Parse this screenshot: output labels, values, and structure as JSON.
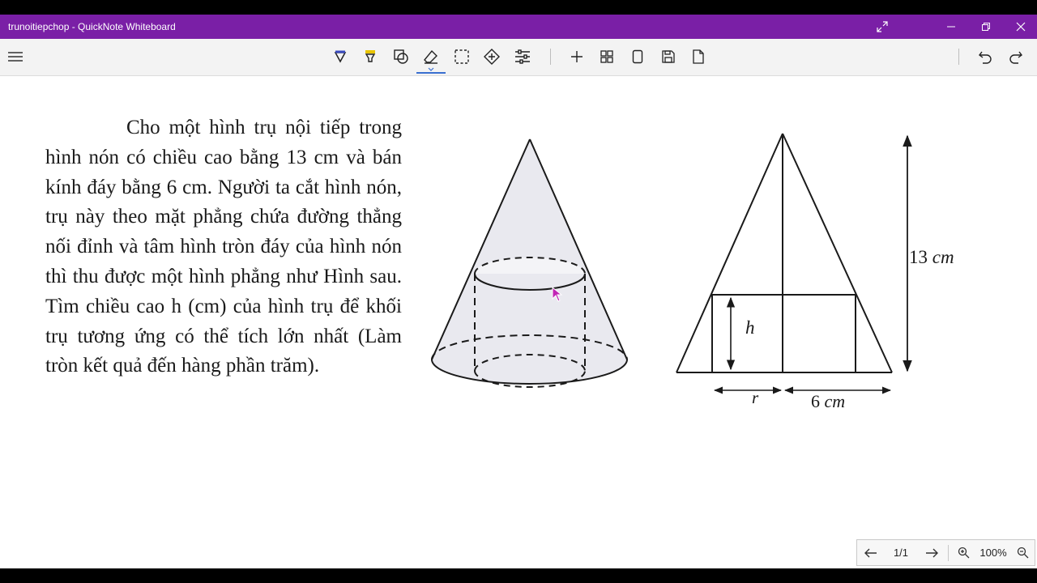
{
  "window": {
    "title": "trunoitiepchop - QuickNote Whiteboard"
  },
  "toolbar": {
    "tools": [
      "pen-icon",
      "highlighter-icon",
      "shapes-icon",
      "eraser-icon",
      "lasso-select-icon",
      "move-icon",
      "settings-sliders-icon",
      "add-icon",
      "grid-icon",
      "page-icon",
      "save-icon",
      "export-icon",
      "undo-icon",
      "redo-icon"
    ],
    "active_tool": "eraser",
    "accent": "#3a6fd0"
  },
  "colors": {
    "title_bar": "#7a1fa6",
    "toolbar": "#f3f3f3",
    "canvas": "#ffffff"
  },
  "problem": {
    "text": "Cho một hình trụ nội tiếp trong hình nón có chiều cao bằng 13 cm và bán kính đáy bằng 6 cm. Người ta cắt hình nón, trụ này theo mặt phẳng chứa đường thẳng nối đỉnh và tâm hình tròn đáy của hình nón thì thu được một hình phẳng như Hình sau. Tìm chiều cao h (cm) của hình trụ để khối trụ tương ứng có thể tích lớn nhất (Làm tròn kết quả đến hàng phần trăm)."
  },
  "figure": {
    "height_label": "13",
    "height_unit": "cm",
    "h_label": "h",
    "r_label": "r",
    "base_label": "6",
    "base_unit": "cm"
  },
  "pager": {
    "page": "1/1",
    "zoom": "100%"
  }
}
